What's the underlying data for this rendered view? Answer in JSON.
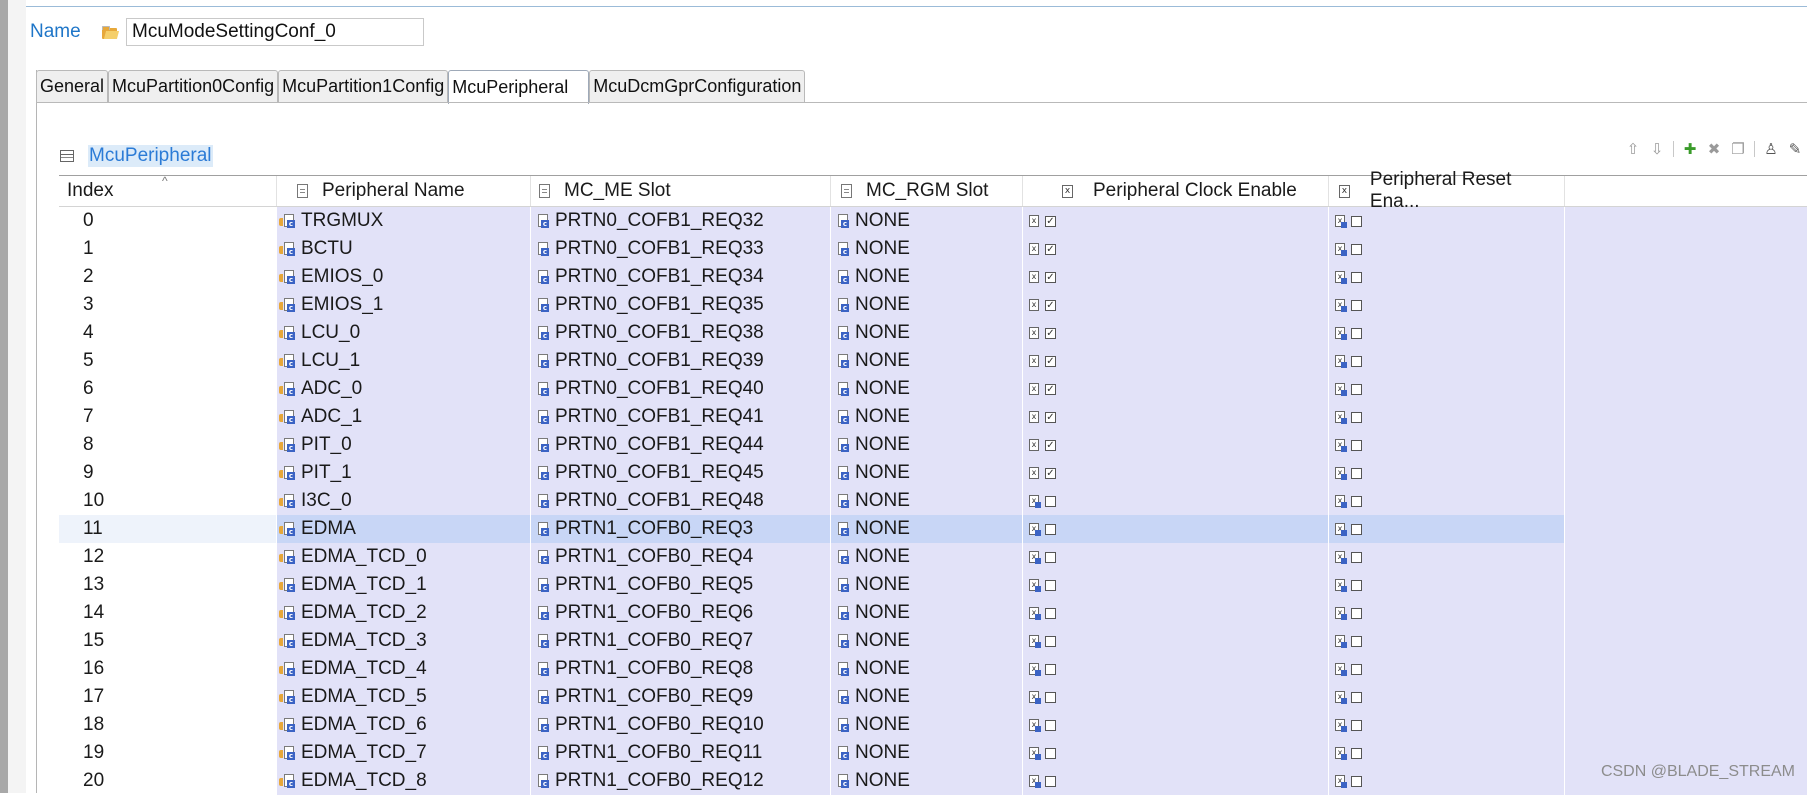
{
  "name_field": {
    "label": "Name",
    "value": "McuModeSettingConf_0"
  },
  "tabs": [
    {
      "label": "General",
      "active": false
    },
    {
      "label": "McuPartition0Config",
      "active": false
    },
    {
      "label": "McuPartition1Config",
      "active": false
    },
    {
      "label": "McuPeripheral",
      "active": true
    },
    {
      "label": "McuDcmGprConfiguration",
      "active": false
    }
  ],
  "section": {
    "title": "McuPeripheral"
  },
  "toolbar": [
    "move-up-icon",
    "move-down-icon",
    "add-icon",
    "delete-icon",
    "copy-icon",
    "person-icon",
    "edit-icon"
  ],
  "table": {
    "columns": [
      "Index",
      "Peripheral Name",
      "MC_ME Slot",
      "MC_RGM Slot",
      "Peripheral Clock Enable",
      "Peripheral Reset Ena..."
    ],
    "selected_index": 11,
    "rows": [
      {
        "index": "0",
        "name": "TRGMUX",
        "me": "PRTN0_COFB1_REQ32",
        "rgm": "NONE",
        "clock": true,
        "reset": false
      },
      {
        "index": "1",
        "name": "BCTU",
        "me": "PRTN0_COFB1_REQ33",
        "rgm": "NONE",
        "clock": true,
        "reset": false
      },
      {
        "index": "2",
        "name": "EMIOS_0",
        "me": "PRTN0_COFB1_REQ34",
        "rgm": "NONE",
        "clock": true,
        "reset": false
      },
      {
        "index": "3",
        "name": "EMIOS_1",
        "me": "PRTN0_COFB1_REQ35",
        "rgm": "NONE",
        "clock": true,
        "reset": false
      },
      {
        "index": "4",
        "name": "LCU_0",
        "me": "PRTN0_COFB1_REQ38",
        "rgm": "NONE",
        "clock": true,
        "reset": false
      },
      {
        "index": "5",
        "name": "LCU_1",
        "me": "PRTN0_COFB1_REQ39",
        "rgm": "NONE",
        "clock": true,
        "reset": false
      },
      {
        "index": "6",
        "name": "ADC_0",
        "me": "PRTN0_COFB1_REQ40",
        "rgm": "NONE",
        "clock": true,
        "reset": false
      },
      {
        "index": "7",
        "name": "ADC_1",
        "me": "PRTN0_COFB1_REQ41",
        "rgm": "NONE",
        "clock": true,
        "reset": false
      },
      {
        "index": "8",
        "name": "PIT_0",
        "me": "PRTN0_COFB1_REQ44",
        "rgm": "NONE",
        "clock": true,
        "reset": false
      },
      {
        "index": "9",
        "name": "PIT_1",
        "me": "PRTN0_COFB1_REQ45",
        "rgm": "NONE",
        "clock": true,
        "reset": false
      },
      {
        "index": "10",
        "name": "I3C_0",
        "me": "PRTN0_COFB1_REQ48",
        "rgm": "NONE",
        "clock": false,
        "reset": false
      },
      {
        "index": "11",
        "name": "EDMA",
        "me": "PRTN1_COFB0_REQ3",
        "rgm": "NONE",
        "clock": false,
        "reset": false
      },
      {
        "index": "12",
        "name": "EDMA_TCD_0",
        "me": "PRTN1_COFB0_REQ4",
        "rgm": "NONE",
        "clock": false,
        "reset": false
      },
      {
        "index": "13",
        "name": "EDMA_TCD_1",
        "me": "PRTN1_COFB0_REQ5",
        "rgm": "NONE",
        "clock": false,
        "reset": false
      },
      {
        "index": "14",
        "name": "EDMA_TCD_2",
        "me": "PRTN1_COFB0_REQ6",
        "rgm": "NONE",
        "clock": false,
        "reset": false
      },
      {
        "index": "15",
        "name": "EDMA_TCD_3",
        "me": "PRTN1_COFB0_REQ7",
        "rgm": "NONE",
        "clock": false,
        "reset": false
      },
      {
        "index": "16",
        "name": "EDMA_TCD_4",
        "me": "PRTN1_COFB0_REQ8",
        "rgm": "NONE",
        "clock": false,
        "reset": false
      },
      {
        "index": "17",
        "name": "EDMA_TCD_5",
        "me": "PRTN1_COFB0_REQ9",
        "rgm": "NONE",
        "clock": false,
        "reset": false
      },
      {
        "index": "18",
        "name": "EDMA_TCD_6",
        "me": "PRTN1_COFB0_REQ10",
        "rgm": "NONE",
        "clock": false,
        "reset": false
      },
      {
        "index": "19",
        "name": "EDMA_TCD_7",
        "me": "PRTN1_COFB0_REQ11",
        "rgm": "NONE",
        "clock": false,
        "reset": false
      },
      {
        "index": "20",
        "name": "EDMA_TCD_8",
        "me": "PRTN1_COFB0_REQ12",
        "rgm": "NONE",
        "clock": false,
        "reset": false
      }
    ]
  },
  "watermark": "CSDN @BLADE_STREAM"
}
